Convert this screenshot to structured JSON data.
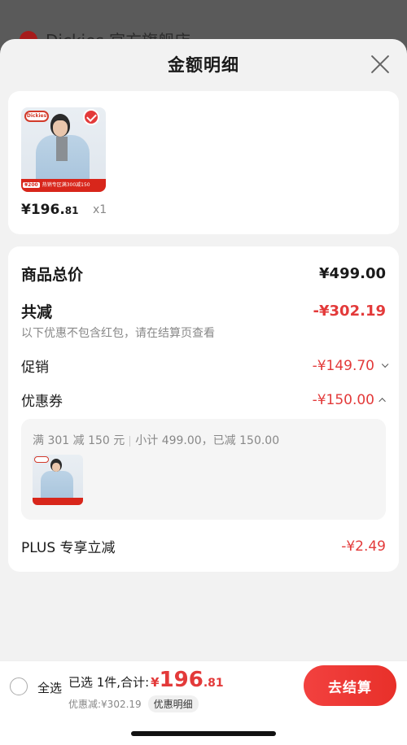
{
  "background": {
    "store_name": "Dickies 官方旗舰店"
  },
  "sheet": {
    "title": "金额明细"
  },
  "product": {
    "price_int": "¥196.",
    "price_dec": "81",
    "qty": "x1",
    "brand": "Dickies",
    "promo_tag": "¥200",
    "promo_text": "热销专区满300减150"
  },
  "details": {
    "total_label": "商品总价",
    "total_value": "¥499.00",
    "reduce_label": "共减",
    "reduce_value": "-¥302.19",
    "reduce_note": "以下优惠不包含红包，请在结算页查看",
    "promo_label": "促销",
    "promo_value": "-¥149.70",
    "coupon_label": "优惠券",
    "coupon_value": "-¥150.00",
    "coupon_rule": "满 301 减 150 元",
    "coupon_subtotal": "小计 499.00，已减 150.00",
    "plus_label": "PLUS 专享立减",
    "plus_value": "-¥2.49"
  },
  "bottom": {
    "select_all": "全选",
    "selected_summary": "已选 1件,合计:",
    "yen": "¥",
    "total_int": "196",
    "total_dec": ".81",
    "discount_text": "优惠减:¥302.19",
    "detail_pill": "优惠明细",
    "checkout": "去结算"
  },
  "colors": {
    "accent_red": "#e33a3a",
    "text_primary": "#1a1a1a",
    "text_secondary": "#888888"
  }
}
